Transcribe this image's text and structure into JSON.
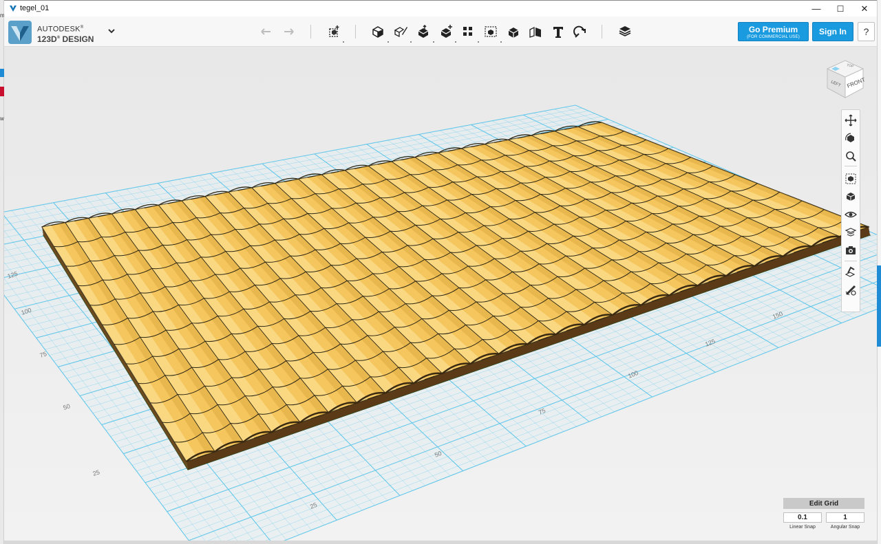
{
  "window": {
    "title": "tegel_01",
    "controls": {
      "minimize": "—",
      "maximize": "☐",
      "close": "✕"
    }
  },
  "brand": {
    "company": "AUTODESK",
    "product": "123D",
    "product_suffix": "DESIGN",
    "registered": "®"
  },
  "toolbar": {
    "buttons": [
      {
        "name": "undo",
        "icon": "undo-icon"
      },
      {
        "name": "redo",
        "icon": "redo-icon"
      },
      {
        "name": "transform",
        "icon": "transform-icon"
      },
      {
        "name": "primitives",
        "icon": "primitives-icon"
      },
      {
        "name": "sketch",
        "icon": "sketch-icon"
      },
      {
        "name": "construct",
        "icon": "construct-icon"
      },
      {
        "name": "modify",
        "icon": "modify-icon"
      },
      {
        "name": "pattern",
        "icon": "pattern-icon"
      },
      {
        "name": "grouping",
        "icon": "grouping-icon"
      },
      {
        "name": "combine",
        "icon": "combine-icon"
      },
      {
        "name": "measure",
        "icon": "measure-icon"
      },
      {
        "name": "text",
        "icon": "text-icon"
      },
      {
        "name": "snap",
        "icon": "snap-icon"
      },
      {
        "name": "material",
        "icon": "material-icon"
      }
    ],
    "premium_label": "Go Premium",
    "premium_sub": "(FOR COMMERCIAL USE)",
    "signin_label": "Sign In",
    "help_label": "?"
  },
  "viewcube": {
    "top": "TOP",
    "left": "LEFT",
    "front": "FRONT"
  },
  "grid": {
    "axis_left_labels": [
      "25",
      "50",
      "75",
      "100",
      "125"
    ],
    "axis_bottom_labels": [
      "25",
      "50",
      "75",
      "100",
      "125",
      "150"
    ]
  },
  "navbar": {
    "items": [
      "pan-icon",
      "orbit-icon",
      "zoom-icon",
      "fit-icon",
      "view-mode-icon",
      "visibility-icon",
      "material-view-icon",
      "screenshot-icon",
      "snap-tool-icon",
      "ruler-icon"
    ]
  },
  "edit_grid": {
    "button_label": "Edit Grid",
    "linear_snap_value": "0.1",
    "linear_snap_label": "Linear Snap",
    "angular_snap_value": "1",
    "angular_snap_label": "Angular Snap"
  },
  "colors": {
    "accent": "#1a9be0",
    "tile_fill": "#f5c65e",
    "tile_outline": "#2a2412",
    "base_green": "#4ddb4d",
    "grid_line": "#5fc6ea",
    "viewport_bg": "#ececec"
  }
}
